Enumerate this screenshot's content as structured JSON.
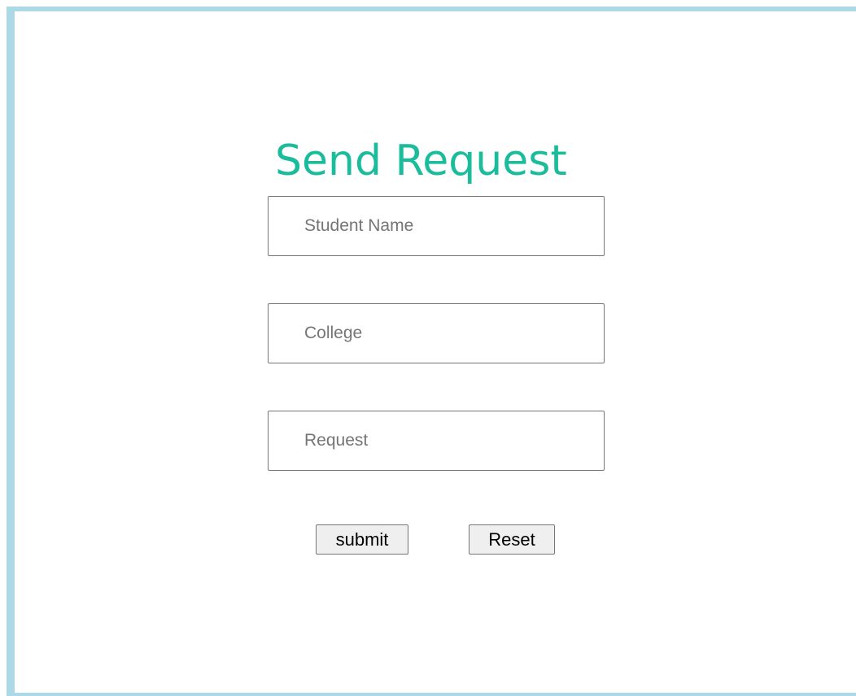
{
  "form": {
    "title": "Send Request",
    "fields": {
      "student_name": {
        "placeholder": "Student Name",
        "value": ""
      },
      "college": {
        "placeholder": "College",
        "value": ""
      },
      "request": {
        "placeholder": "Request",
        "value": ""
      }
    },
    "buttons": {
      "submit_label": "submit",
      "reset_label": "Reset"
    }
  },
  "colors": {
    "title": "#1abc9c",
    "frame_border": "#add8e6"
  }
}
